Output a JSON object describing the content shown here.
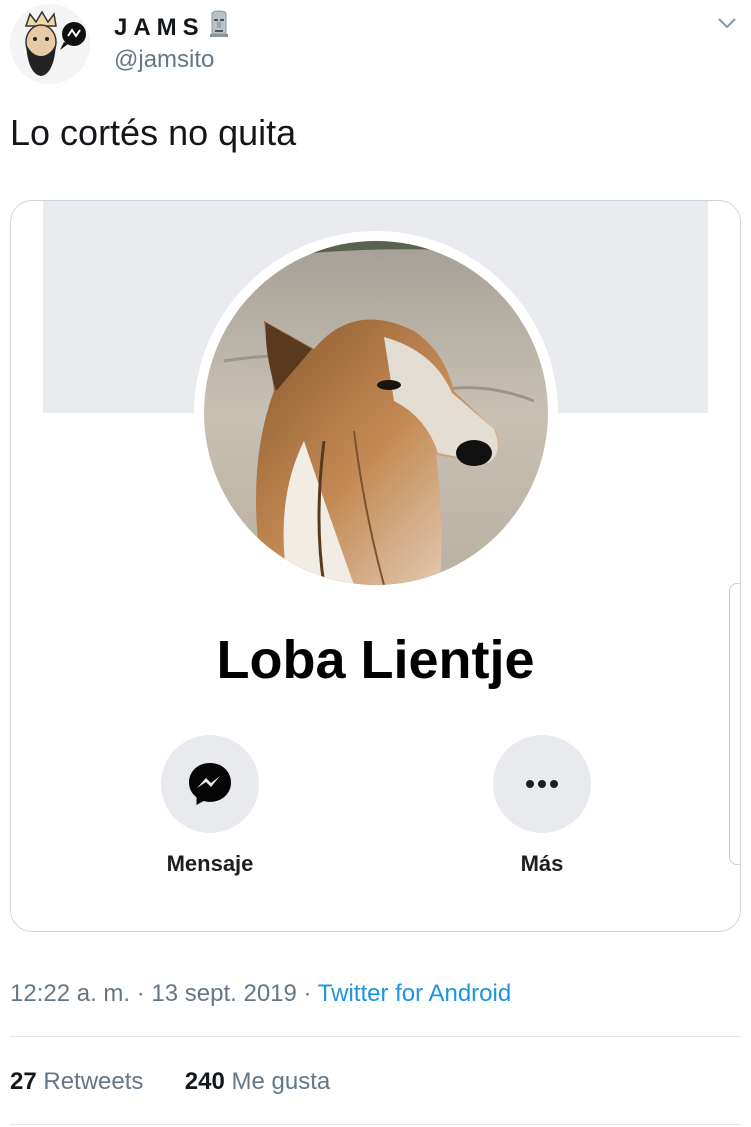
{
  "author": {
    "display_name": "JAMS",
    "handle": "@jamsito",
    "avatar_icon": "bearded-man-avatar",
    "name_emoji_icon": "moai-icon"
  },
  "menu": {
    "icon": "chevron-down-icon"
  },
  "tweet": {
    "text": "Lo cortés no quita"
  },
  "card": {
    "profile_name": "Loba Lientje",
    "photo_icon": "dog-photo",
    "actions": [
      {
        "label": "Mensaje",
        "icon": "messenger-icon"
      },
      {
        "label": "Más",
        "icon": "more-dots-icon"
      }
    ]
  },
  "meta": {
    "time": "12:22 a. m.",
    "separator": "·",
    "date": "13 sept. 2019",
    "source": "Twitter for Android"
  },
  "stats": {
    "retweets_count": "27",
    "retweets_label": "Retweets",
    "likes_count": "240",
    "likes_label": "Me gusta"
  },
  "colors": {
    "link": "#1b95e0",
    "secondary_text": "#657786",
    "border": "#ccd6dd",
    "cover": "#e9ebee",
    "action_bg": "#e8eaed"
  }
}
